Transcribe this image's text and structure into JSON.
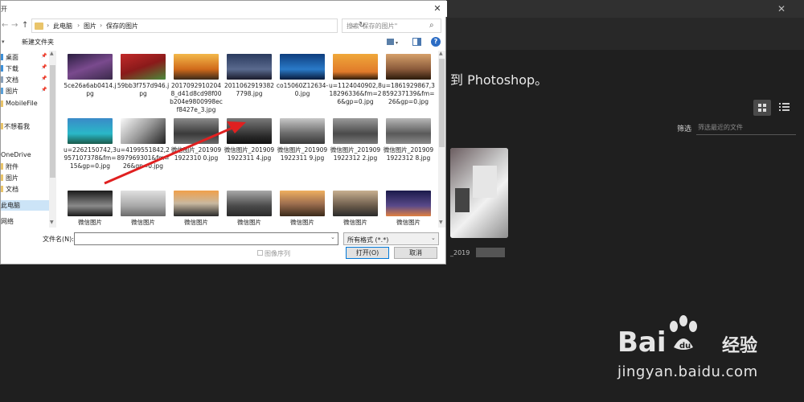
{
  "dialog": {
    "title": "开",
    "close": "✕",
    "nav": {
      "back": "←",
      "forward": "→",
      "up": "↑"
    },
    "breadcrumb": [
      "此电脑",
      "图片",
      "保存的图片"
    ],
    "search_placeholder": "搜索\"保存的图片\"",
    "new_folder": "新建文件夹",
    "help": "?"
  },
  "sidebar": {
    "items": [
      {
        "label": "桌面",
        "pinned": true
      },
      {
        "label": "下载",
        "pinned": true
      },
      {
        "label": "文档",
        "pinned": true
      },
      {
        "label": "图片",
        "pinned": true
      },
      {
        "label": "MobileFile",
        "pinned": false
      },
      {
        "label": "不想看我",
        "pinned": false
      },
      {
        "label": "OneDrive",
        "pinned": false
      },
      {
        "label": "附件",
        "pinned": false
      },
      {
        "label": "图片",
        "pinned": false
      },
      {
        "label": "文档",
        "pinned": false
      },
      {
        "label": "此电脑",
        "pinned": false,
        "selected": true
      },
      {
        "label": "网络",
        "pinned": false
      }
    ]
  },
  "files": [
    {
      "name": "5ce26a6ab0414.jpg",
      "color": "#5a3a66"
    },
    {
      "name": "59bb3f757d946.jpg",
      "color": "#b3262a"
    },
    {
      "name": "20170929102048_d41d8cd98f00b204e9800998ecf8427e_3.jpg",
      "color": "#d98a2b"
    },
    {
      "name": "20110629193827798.jpg",
      "color": "#3b4a6e"
    },
    {
      "name": "co15060Z12634-0.jpg",
      "color": "#1f5fa0"
    },
    {
      "name": "u=1124040902,818296336&fm=26&gp=0.jpg",
      "color": "#e8962f"
    },
    {
      "name": "u=1861929867,3859237139&fm=26&gp=0.jpg",
      "color": "#b27a52"
    },
    {
      "name": "u=2262150742,3957107378&fm=15&gp=0.jpg",
      "color": "#2aa0b8"
    },
    {
      "name": "u=4199551842,2897969301&fm=26&gp=0.jpg",
      "color": "#d9d9d9"
    },
    {
      "name": "微信图片_2019091922310 0.jpg",
      "color": "#6e6e6e"
    },
    {
      "name": "微信图片_2019091922311 4.jpg",
      "color": "#4a4a4a"
    },
    {
      "name": "微信图片_2019091922311 9.jpg",
      "color": "#9a9a9a"
    },
    {
      "name": "微信图片_2019091922312 2.jpg",
      "color": "#7c7c7c"
    },
    {
      "name": "微信图片_2019091922312 8.jpg",
      "color": "#8a8a8a"
    },
    {
      "name": "微信图片",
      "color": "#3c3c3c"
    },
    {
      "name": "微信图片",
      "color": "#bdbdbd"
    },
    {
      "name": "微信图片",
      "color": "#c98a4a"
    },
    {
      "name": "微信图片",
      "color": "#5a5a5a"
    },
    {
      "name": "微信图片",
      "color": "#b07a4a"
    },
    {
      "name": "微信图片",
      "color": "#6a5e52"
    },
    {
      "name": "微信图片",
      "color": "#3a3e66"
    }
  ],
  "bottom": {
    "filename_label": "文件名(N):",
    "filename_value": "",
    "filetype": "所有格式 (*.*)",
    "sequence_label": "图像序列",
    "open": "打开(O)",
    "cancel": "取消"
  },
  "photoshop": {
    "close": "✕",
    "welcome": "到 Photoshop。",
    "filter_label": "筛选",
    "filter_placeholder": "筛选最近的文件",
    "recent_name": "_2019"
  },
  "watermark": {
    "brand": "Bai",
    "brand2": "经验",
    "url": "jingyan.baidu.com"
  },
  "accent": "#0078d7",
  "arrow_color": "#e02020"
}
